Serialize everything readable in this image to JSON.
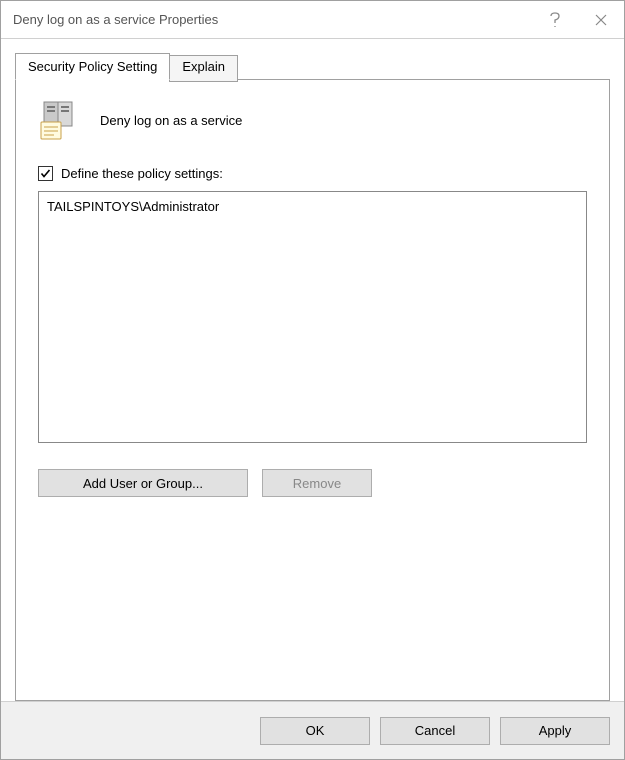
{
  "window": {
    "title": "Deny log on as a service Properties"
  },
  "tabs": {
    "security": "Security Policy Setting",
    "explain": "Explain"
  },
  "policy": {
    "title": "Deny log on as a service",
    "checkbox_label": "Define these policy settings:",
    "checked": true,
    "entries": [
      "TAILSPINTOYS\\Administrator"
    ]
  },
  "buttons": {
    "add": "Add User or Group...",
    "remove": "Remove",
    "ok": "OK",
    "cancel": "Cancel",
    "apply": "Apply"
  }
}
